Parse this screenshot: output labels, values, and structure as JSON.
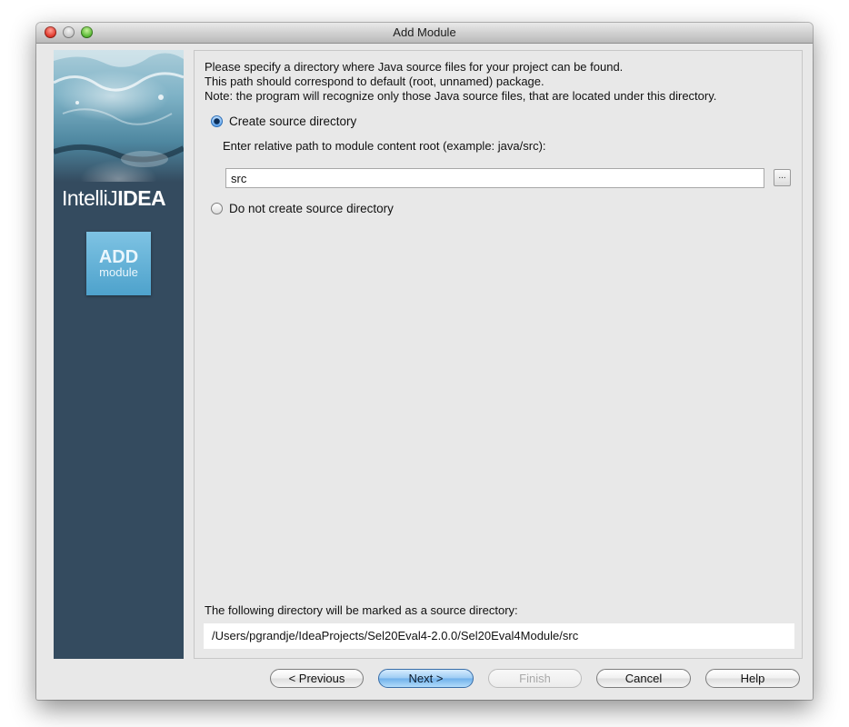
{
  "window": {
    "title": "Add Module"
  },
  "sidebar": {
    "brand_light": "IntelliJ",
    "brand_bold": "IDEA",
    "badge_line1": "ADD",
    "badge_line2": "module"
  },
  "intro": {
    "line1": "Please specify a directory where Java source files for your project can be found.",
    "line2": "This path should correspond to default (root, unnamed) package.",
    "line3": "Note: the program will recognize only those Java source files, that are located under this directory."
  },
  "options": {
    "create_label": "Create source directory",
    "create_selected": true,
    "hint": "Enter relative path to module content root  (example: java/src):",
    "path_value": "src",
    "browse_label": "...",
    "no_create_label": "Do not create source directory",
    "no_create_selected": false
  },
  "result": {
    "label": "The following directory will be marked as a source directory:",
    "path": "/Users/pgrandje/IdeaProjects/Sel20Eval4-2.0.0/Sel20Eval4Module/src"
  },
  "buttons": {
    "previous": "< Previous",
    "next": "Next >",
    "finish": "Finish",
    "cancel": "Cancel",
    "help": "Help"
  }
}
